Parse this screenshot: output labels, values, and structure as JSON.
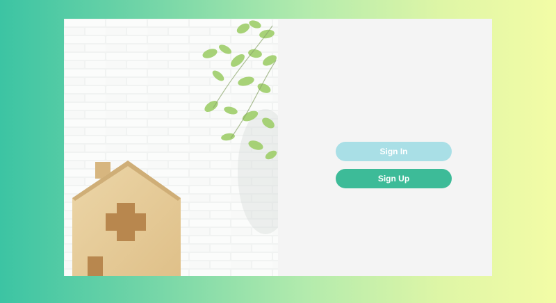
{
  "auth": {
    "sign_in_label": "Sign In",
    "sign_up_label": "Sign Up"
  },
  "colors": {
    "background_start": "#3cc4a3",
    "background_end": "#f3fca6",
    "panel": "#f4f4f4",
    "sign_in_button": "#a9dfe6",
    "sign_up_button": "#3dbb98"
  },
  "hero": {
    "image_subject": "wooden-house-with-medical-cross-icon"
  }
}
